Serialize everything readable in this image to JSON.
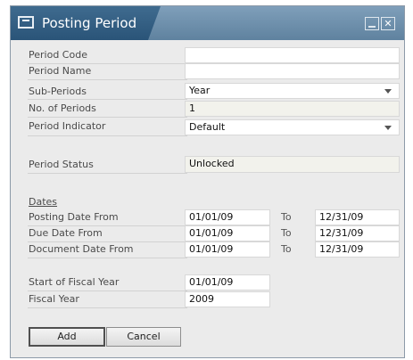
{
  "window": {
    "title": "Posting Period"
  },
  "fields": {
    "period_code": {
      "label": "Period Code",
      "value": ""
    },
    "period_name": {
      "label": "Period Name",
      "value": ""
    },
    "sub_periods": {
      "label": "Sub-Periods",
      "value": "Year"
    },
    "no_of_periods": {
      "label": "No. of Periods",
      "value": "1"
    },
    "period_indicator": {
      "label": "Period Indicator",
      "value": "Default"
    },
    "period_status": {
      "label": "Period Status",
      "value": "Unlocked"
    }
  },
  "dates": {
    "section_label": "Dates",
    "to_label": "To",
    "posting": {
      "label": "Posting Date From",
      "from": "01/01/09",
      "to": "12/31/09"
    },
    "due": {
      "label": "Due Date From",
      "from": "01/01/09",
      "to": "12/31/09"
    },
    "document": {
      "label": "Document Date From",
      "from": "01/01/09",
      "to": "12/31/09"
    }
  },
  "fiscal": {
    "start": {
      "label": "Start of Fiscal Year",
      "value": "01/01/09"
    },
    "year": {
      "label": "Fiscal Year",
      "value": "2009"
    }
  },
  "buttons": {
    "add": "Add",
    "cancel": "Cancel"
  }
}
